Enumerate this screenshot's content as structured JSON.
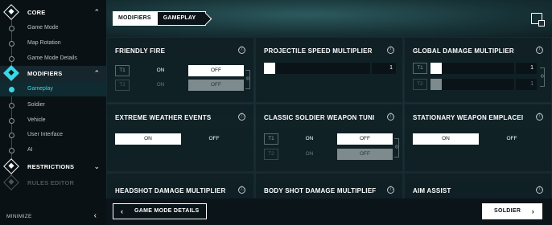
{
  "sidebar": {
    "sections": [
      {
        "label": "CORE",
        "chevron": "⌃",
        "state": "normal"
      },
      {
        "label": "MODIFIERS",
        "chevron": "⌃",
        "state": "active"
      },
      {
        "label": "RESTRICTIONS",
        "chevron": "⌄",
        "state": "normal"
      },
      {
        "label": "RULES EDITOR",
        "chevron": "",
        "state": "disabled"
      }
    ],
    "core_items": [
      "Game Mode",
      "Map Rotation",
      "Game Mode Details"
    ],
    "modifier_items": [
      "Gameplay",
      "Soldier",
      "Vehicle",
      "User Interface",
      "AI"
    ],
    "active_item": "Gameplay",
    "minimize_label": "MINIMIZE",
    "minimize_chevron": "‹"
  },
  "breadcrumb": [
    "MODIFIERS",
    "GAMEPLAY"
  ],
  "settings": {
    "friendly_fire": {
      "title": "FRIENDLY FIRE",
      "team1": {
        "tag": "T1",
        "on": "ON",
        "off": "OFF"
      },
      "team2": {
        "tag": "T2",
        "on": "ON",
        "off": "OFF"
      }
    },
    "projectile_speed": {
      "title": "PROJECTILE SPEED MULTIPLIER",
      "value": "1"
    },
    "global_damage": {
      "title": "GLOBAL DAMAGE MULTIPLIER",
      "team1": {
        "tag": "T1",
        "value": "1"
      },
      "team2": {
        "tag": "T2",
        "value": "1"
      }
    },
    "extreme_weather": {
      "title": "EXTREME WEATHER EVENTS",
      "on": "ON",
      "off": "OFF"
    },
    "classic_soldier": {
      "title": "CLASSIC SOLDIER WEAPON TUNI",
      "team1": {
        "tag": "T1",
        "on": "ON",
        "off": "OFF"
      },
      "team2": {
        "tag": "T2",
        "on": "ON",
        "off": "OFF"
      }
    },
    "stationary_weapon": {
      "title": "STATIONARY WEAPON EMPLACEI",
      "on": "ON",
      "off": "OFF"
    },
    "headshot_damage": {
      "title": "HEADSHOT DAMAGE MULTIPLIER"
    },
    "body_shot_damage": {
      "title": "BODY SHOT DAMAGE MULTIPLIEF"
    },
    "aim_assist": {
      "title": "AIM ASSIST"
    }
  },
  "footer": {
    "back_label": "GAME MODE DETAILS",
    "back_chevron": "‹",
    "next_label": "SOLDIER",
    "next_chevron": "›"
  },
  "icons": {
    "info": "ⓘ",
    "link": "⊖"
  }
}
